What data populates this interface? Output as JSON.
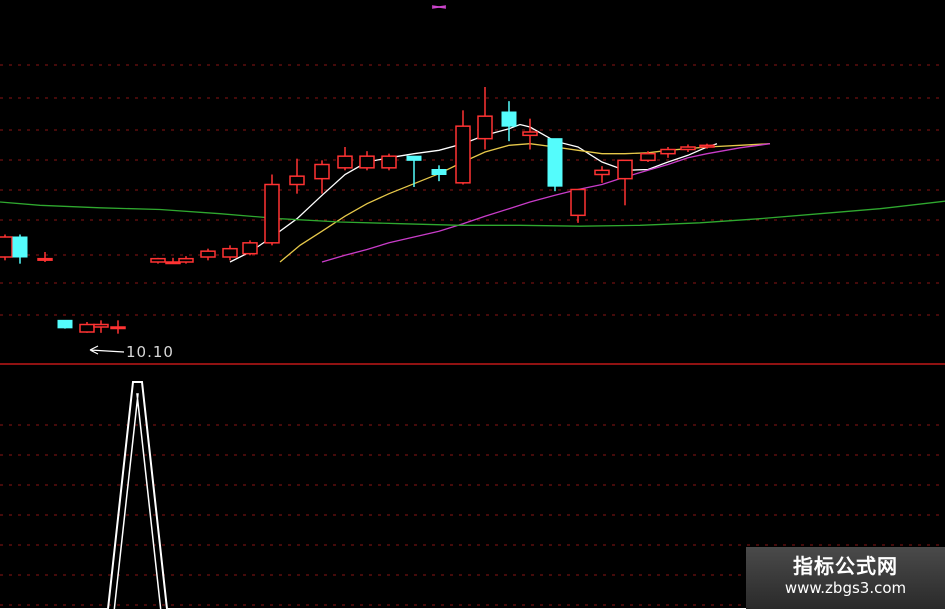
{
  "chart_data": {
    "type": "candlestick",
    "title": "",
    "price_label": "10.10",
    "colors": {
      "background": "#000000",
      "up": "#ff3333",
      "down": "#54fcfc",
      "ma_white": "#ffffff",
      "ma_yellow": "#e6c84a",
      "ma_magenta": "#c83cc8",
      "ma_green": "#2fa82f",
      "grid": "#8a1515",
      "separator": "#c01818",
      "indicator": "#ffffff",
      "top_marker": "#cc44cc"
    },
    "ylim": [
      9.8,
      14.0
    ],
    "candles": [
      {
        "x": 5,
        "o": 11.06,
        "c": 11.3,
        "h": 11.33,
        "l": 11.02
      },
      {
        "x": 20,
        "o": 11.3,
        "c": 11.06,
        "h": 11.33,
        "l": 10.98
      },
      {
        "x": 45,
        "o": 11.04,
        "c": 11.04,
        "h": 11.12,
        "l": 11.0
      },
      {
        "x": 65,
        "o": 10.3,
        "c": 10.21,
        "h": 10.3,
        "l": 10.2
      },
      {
        "x": 87,
        "o": 10.16,
        "c": 10.25,
        "h": 10.28,
        "l": 10.15
      },
      {
        "x": 101,
        "o": 10.22,
        "c": 10.25,
        "h": 10.3,
        "l": 10.15
      },
      {
        "x": 118,
        "o": 10.22,
        "c": 10.22,
        "h": 10.3,
        "l": 10.14
      },
      {
        "x": 158,
        "o": 11.0,
        "c": 11.04,
        "h": 11.05,
        "l": 10.98
      },
      {
        "x": 173,
        "o": 11.0,
        "c": 11.0,
        "h": 11.05,
        "l": 10.98
      },
      {
        "x": 186,
        "o": 11.0,
        "c": 11.04,
        "h": 11.07,
        "l": 10.98
      },
      {
        "x": 208,
        "o": 11.06,
        "c": 11.13,
        "h": 11.16,
        "l": 11.02
      },
      {
        "x": 230,
        "o": 11.06,
        "c": 11.16,
        "h": 11.2,
        "l": 11.02
      },
      {
        "x": 250,
        "o": 11.1,
        "c": 11.23,
        "h": 11.26,
        "l": 11.08
      },
      {
        "x": 272,
        "o": 11.23,
        "c": 11.93,
        "h": 12.05,
        "l": 11.2
      },
      {
        "x": 297,
        "o": 11.93,
        "c": 12.03,
        "h": 12.24,
        "l": 11.82
      },
      {
        "x": 322,
        "o": 12.0,
        "c": 12.17,
        "h": 12.22,
        "l": 11.82
      },
      {
        "x": 345,
        "o": 12.13,
        "c": 12.27,
        "h": 12.38,
        "l": 12.1
      },
      {
        "x": 367,
        "o": 12.13,
        "c": 12.27,
        "h": 12.33,
        "l": 12.1
      },
      {
        "x": 389,
        "o": 12.13,
        "c": 12.27,
        "h": 12.3,
        "l": 12.1
      },
      {
        "x": 414,
        "o": 12.27,
        "c": 12.22,
        "h": 12.27,
        "l": 11.9
      },
      {
        "x": 439,
        "o": 12.11,
        "c": 12.05,
        "h": 12.16,
        "l": 11.97
      },
      {
        "x": 463,
        "o": 11.95,
        "c": 12.63,
        "h": 12.82,
        "l": 11.93
      },
      {
        "x": 485,
        "o": 12.48,
        "c": 12.75,
        "h": 13.1,
        "l": 12.35
      },
      {
        "x": 509,
        "o": 12.8,
        "c": 12.63,
        "h": 12.93,
        "l": 12.45
      },
      {
        "x": 530,
        "o": 12.52,
        "c": 12.56,
        "h": 12.72,
        "l": 12.35
      },
      {
        "x": 555,
        "o": 12.48,
        "c": 11.91,
        "h": 12.48,
        "l": 11.85
      },
      {
        "x": 578,
        "o": 11.56,
        "c": 11.87,
        "h": 11.87,
        "l": 11.47
      },
      {
        "x": 602,
        "o": 12.05,
        "c": 12.1,
        "h": 12.15,
        "l": 11.95
      },
      {
        "x": 625,
        "o": 12.0,
        "c": 12.22,
        "h": 12.22,
        "l": 11.68
      },
      {
        "x": 648,
        "o": 12.22,
        "c": 12.3,
        "h": 12.33,
        "l": 12.2
      },
      {
        "x": 668,
        "o": 12.3,
        "c": 12.35,
        "h": 12.38,
        "l": 12.25
      },
      {
        "x": 688,
        "o": 12.35,
        "c": 12.38,
        "h": 12.41,
        "l": 12.32
      },
      {
        "x": 707,
        "o": 12.38,
        "c": 12.4,
        "h": 12.42,
        "l": 12.36
      }
    ],
    "moving_averages": [
      {
        "color_key": "ma_white",
        "points": [
          [
            230,
            11.0
          ],
          [
            250,
            11.12
          ],
          [
            272,
            11.3
          ],
          [
            297,
            11.52
          ],
          [
            322,
            11.8
          ],
          [
            345,
            12.05
          ],
          [
            367,
            12.2
          ],
          [
            389,
            12.25
          ],
          [
            414,
            12.3
          ],
          [
            439,
            12.34
          ],
          [
            463,
            12.42
          ],
          [
            485,
            12.52
          ],
          [
            509,
            12.6
          ],
          [
            520,
            12.65
          ],
          [
            530,
            12.62
          ],
          [
            555,
            12.45
          ],
          [
            578,
            12.38
          ],
          [
            602,
            12.2
          ],
          [
            625,
            12.1
          ],
          [
            648,
            12.11
          ],
          [
            668,
            12.2
          ],
          [
            688,
            12.28
          ],
          [
            707,
            12.38
          ],
          [
            717,
            12.42
          ]
        ]
      },
      {
        "color_key": "ma_yellow",
        "points": [
          [
            280,
            11.0
          ],
          [
            300,
            11.2
          ],
          [
            322,
            11.37
          ],
          [
            345,
            11.55
          ],
          [
            367,
            11.7
          ],
          [
            389,
            11.82
          ],
          [
            414,
            11.94
          ],
          [
            439,
            12.06
          ],
          [
            463,
            12.2
          ],
          [
            485,
            12.32
          ],
          [
            509,
            12.4
          ],
          [
            530,
            12.42
          ],
          [
            555,
            12.38
          ],
          [
            578,
            12.34
          ],
          [
            602,
            12.3
          ],
          [
            625,
            12.3
          ],
          [
            648,
            12.31
          ],
          [
            668,
            12.34
          ],
          [
            688,
            12.36
          ],
          [
            707,
            12.38
          ],
          [
            740,
            12.4
          ],
          [
            770,
            12.42
          ]
        ]
      },
      {
        "color_key": "ma_magenta",
        "points": [
          [
            322,
            11.0
          ],
          [
            345,
            11.08
          ],
          [
            367,
            11.15
          ],
          [
            389,
            11.23
          ],
          [
            414,
            11.3
          ],
          [
            439,
            11.37
          ],
          [
            463,
            11.46
          ],
          [
            485,
            11.55
          ],
          [
            509,
            11.64
          ],
          [
            530,
            11.72
          ],
          [
            555,
            11.8
          ],
          [
            578,
            11.87
          ],
          [
            602,
            11.93
          ],
          [
            625,
            12.02
          ],
          [
            648,
            12.1
          ],
          [
            668,
            12.17
          ],
          [
            688,
            12.25
          ],
          [
            707,
            12.3
          ],
          [
            740,
            12.37
          ],
          [
            770,
            12.42
          ]
        ]
      },
      {
        "color_key": "ma_green",
        "points": [
          [
            0,
            11.72
          ],
          [
            40,
            11.68
          ],
          [
            100,
            11.65
          ],
          [
            160,
            11.63
          ],
          [
            220,
            11.58
          ],
          [
            280,
            11.52
          ],
          [
            340,
            11.48
          ],
          [
            400,
            11.46
          ],
          [
            460,
            11.44
          ],
          [
            520,
            11.44
          ],
          [
            580,
            11.43
          ],
          [
            640,
            11.44
          ],
          [
            700,
            11.47
          ],
          [
            760,
            11.52
          ],
          [
            820,
            11.58
          ],
          [
            880,
            11.64
          ],
          [
            945,
            11.73
          ]
        ]
      }
    ],
    "indicator": {
      "ylim": [
        0,
        1
      ],
      "points": [
        [
          0,
          0
        ],
        [
          108,
          0
        ],
        [
          133,
          1
        ],
        [
          142,
          1
        ],
        [
          167,
          0
        ],
        [
          945,
          0
        ]
      ]
    }
  },
  "watermark": {
    "title": "指标公式网",
    "url": "www.zbgs3.com"
  }
}
